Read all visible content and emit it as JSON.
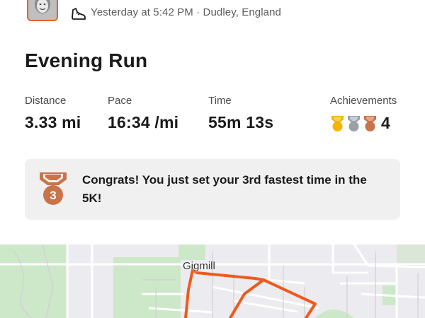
{
  "activity": {
    "timestamp": "Yesterday at 5:42 PM",
    "separator": " · ",
    "location": "Dudley, England",
    "title": "Evening Run"
  },
  "stats": {
    "distance": {
      "label": "Distance",
      "value": "3.33 mi"
    },
    "pace": {
      "label": "Pace",
      "value": "16:34 /mi"
    },
    "time": {
      "label": "Time",
      "value": "55m 13s"
    },
    "achievements": {
      "label": "Achievements",
      "count": "4",
      "medals": [
        "gold",
        "silver",
        "bronze"
      ]
    }
  },
  "banner": {
    "text": "Congrats! You just set your 3rd fastest time in the 5K!",
    "medal_number": "3"
  },
  "map": {
    "place_label": "Gigmill"
  },
  "colors": {
    "accent": "#e8612c",
    "route": "#ef5a1c",
    "gold": "#f4b400",
    "silver": "#9aa0a6",
    "bronze": "#c8734a",
    "banner_bg": "#f0f0f0",
    "map_bg": "#ecebef",
    "park_green": "#cde8c9"
  },
  "icons": {
    "activity_type": "shoe-icon",
    "avatar": "avatar"
  }
}
